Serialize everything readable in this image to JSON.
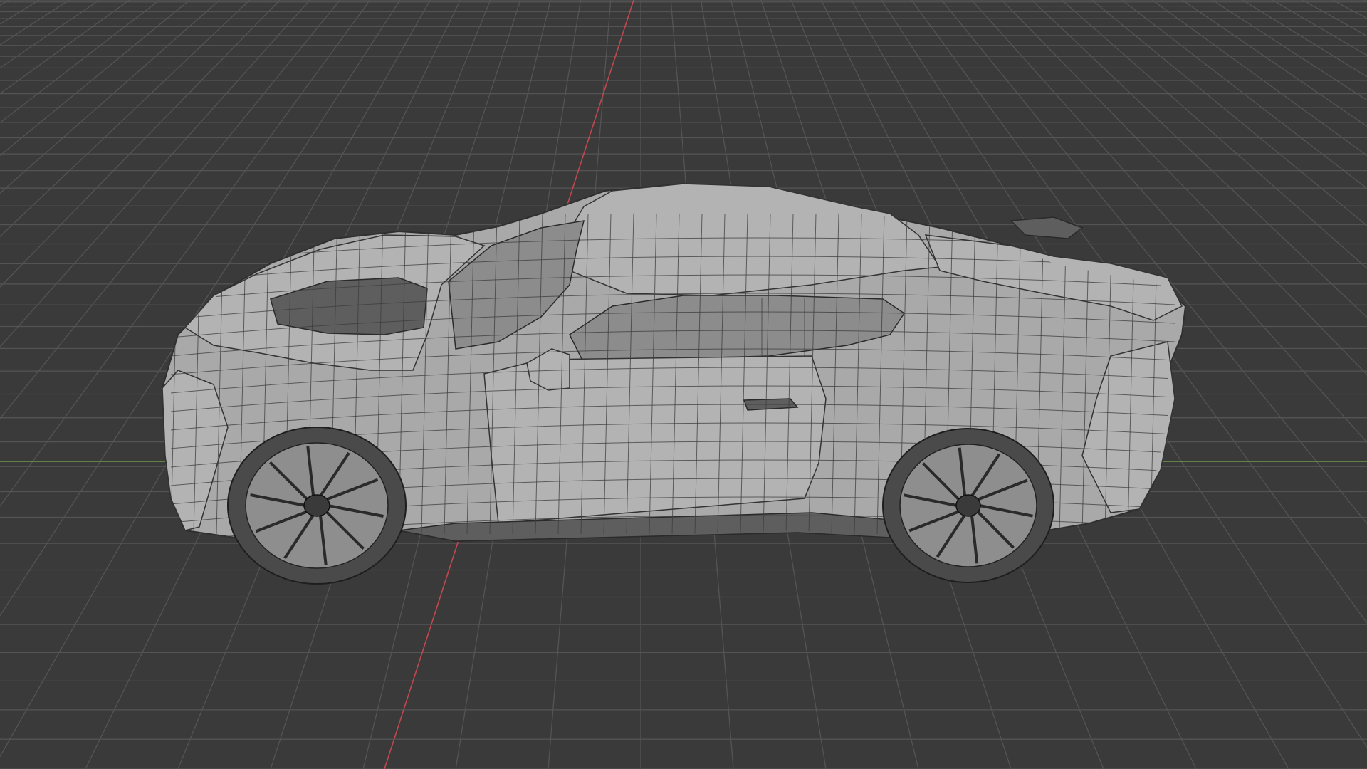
{
  "viewport": {
    "type": "3d-viewport",
    "shading": "wireframe-overlay",
    "object": "sports-car-mesh",
    "colors": {
      "background": "#3a3a3a",
      "grid": "#545454",
      "axis_x": "#c1484f",
      "axis_y": "#6c9a45",
      "mesh": "#a9a9a9",
      "wire": "#3c3c3c"
    },
    "icons": [
      "3d-grid-floor",
      "x-axis-line",
      "y-axis-line",
      "car-mesh",
      "wheel-icon"
    ]
  }
}
